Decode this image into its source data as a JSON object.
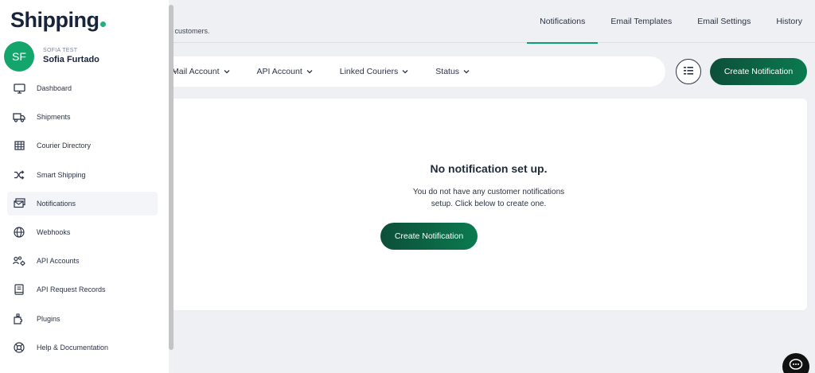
{
  "header": {
    "subtitle_fragment": "r customers."
  },
  "tabs": [
    {
      "label": "Notifications",
      "active": true
    },
    {
      "label": "Email Templates",
      "active": false
    },
    {
      "label": "Email Settings",
      "active": false
    },
    {
      "label": "History",
      "active": false
    }
  ],
  "filters": [
    {
      "label": "Mail Account"
    },
    {
      "label": "API Account"
    },
    {
      "label": "Linked Couriers"
    },
    {
      "label": "Status"
    }
  ],
  "toolbar": {
    "create_label": "Create Notification"
  },
  "empty_state": {
    "title": "No notification set up.",
    "description_line1": "You do not have any customer notifications",
    "description_line2": "setup. Click below to create one.",
    "button_label": "Create Notification"
  },
  "sidebar": {
    "logo_text": "Shipping",
    "avatar_initials": "SF",
    "org_name": "SOFIA TEST",
    "user_name": "Sofia Furtado",
    "items": [
      {
        "label": "Dashboard",
        "icon": "monitor-icon",
        "active": false
      },
      {
        "label": "Shipments",
        "icon": "truck-icon",
        "active": false
      },
      {
        "label": "Courier Directory",
        "icon": "grid-icon",
        "active": false
      },
      {
        "label": "Smart Shipping",
        "icon": "shuffle-icon",
        "active": false
      },
      {
        "label": "Notifications",
        "icon": "mail-stack-icon",
        "active": true
      },
      {
        "label": "Webhooks",
        "icon": "globe-icon",
        "active": false
      },
      {
        "label": "API Accounts",
        "icon": "users-gear-icon",
        "active": false
      },
      {
        "label": "API Request Records",
        "icon": "book-icon",
        "active": false
      },
      {
        "label": "Plugins",
        "icon": "puzzle-icon",
        "active": false
      },
      {
        "label": "Help & Documentation",
        "icon": "lifebuoy-icon",
        "active": false
      }
    ]
  },
  "colors": {
    "accent_green": "#0e9d6e",
    "button_dark_green": "#0d4f3a",
    "avatar_green": "#13a56b"
  }
}
